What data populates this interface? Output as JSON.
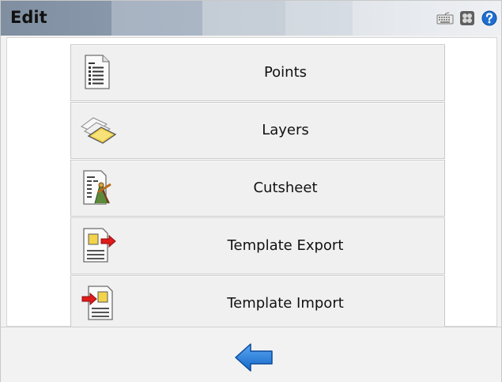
{
  "window": {
    "title": "Edit"
  },
  "titlebar_icons": [
    "keyboard-icon",
    "settings-icon",
    "help-icon"
  ],
  "menu": {
    "items": [
      {
        "label": "Points",
        "icon": "points-list-icon"
      },
      {
        "label": "Layers",
        "icon": "layers-icon"
      },
      {
        "label": "Cutsheet",
        "icon": "cutsheet-icon"
      },
      {
        "label": "Template Export",
        "icon": "template-export-icon"
      },
      {
        "label": "Template Import",
        "icon": "template-import-icon"
      }
    ]
  },
  "footer": {
    "back_icon": "back-arrow-icon"
  },
  "colors": {
    "accent_blue": "#1a73d6",
    "export_red": "#e01b1b",
    "folder_yellow": "#f2d34a"
  }
}
